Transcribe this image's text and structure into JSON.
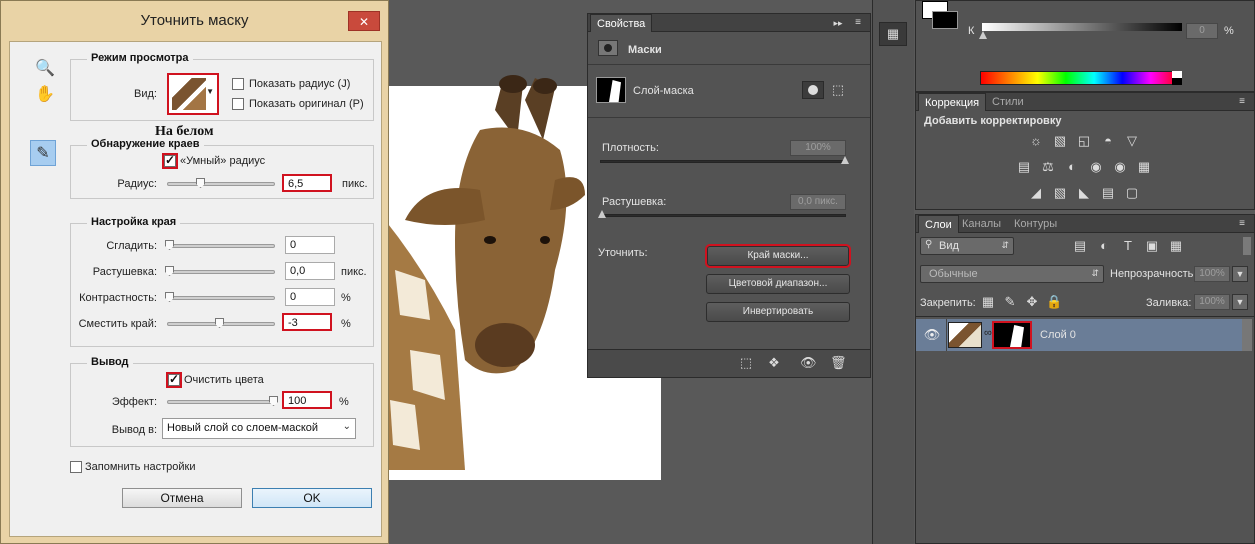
{
  "dialog": {
    "title": "Уточнить маску",
    "close_label": "✕",
    "view_mode": {
      "title": "Режим просмотра",
      "view_label": "Вид:",
      "show_radius": "Показать радиус (J)",
      "show_original": "Показать оригинал (P)",
      "view_name": "На белом"
    },
    "edge_detection": {
      "title": "Обнаружение краев",
      "smart_radius": "«Умный» радиус",
      "smart_radius_checked": true,
      "radius_label": "Радиус:",
      "radius_value": "6,5",
      "radius_unit": "пикс.",
      "radius_slider": 0.25
    },
    "adjust_edge": {
      "title": "Настройка края",
      "smooth_label": "Сгладить:",
      "smooth_value": "0",
      "feather_label": "Растушевка:",
      "feather_value": "0,0",
      "feather_unit": "пикс.",
      "contrast_label": "Контрастность:",
      "contrast_value": "0",
      "contrast_unit": "%",
      "shift_label": "Сместить край:",
      "shift_value": "-3",
      "shift_unit": "%",
      "shift_slider": 0.47
    },
    "output": {
      "title": "Вывод",
      "decontaminate": "Очистить цвета",
      "decontaminate_checked": true,
      "amount_label": "Эффект:",
      "amount_value": "100",
      "amount_unit": "%",
      "output_to_label": "Вывод в:",
      "output_to_value": "Новый слой со слоем-маской"
    },
    "remember": "Запомнить настройки",
    "cancel": "Отмена",
    "ok": "OK"
  },
  "properties": {
    "tab": "Свойства",
    "section": "Маски",
    "mask_type": "Слой-маска",
    "density_label": "Плотность:",
    "density_value": "100%",
    "feather_label": "Растушевка:",
    "feather_value": "0,0 пикс.",
    "refine_label": "Уточнить:",
    "mask_edge_btn": "Край маски...",
    "color_range_btn": "Цветовой диапазон...",
    "invert_btn": "Инвертировать"
  },
  "color": {
    "k_label": "К",
    "k_value": "0",
    "k_unit": "%"
  },
  "adjustments": {
    "tabs": [
      "Коррекция",
      "Стили"
    ],
    "title": "Добавить корректировку"
  },
  "layers": {
    "tabs": [
      "Слои",
      "Каналы",
      "Контуры"
    ],
    "filter_label": "Вид",
    "blend_mode": "Обычные",
    "opacity_label": "Непрозрачность:",
    "opacity_value": "100%",
    "lock_label": "Закрепить:",
    "fill_label": "Заливка:",
    "fill_value": "100%",
    "layer_name": "Слой 0"
  },
  "colors": {
    "highlight": "#d0121f",
    "layer_selected": "#6a7d97"
  }
}
